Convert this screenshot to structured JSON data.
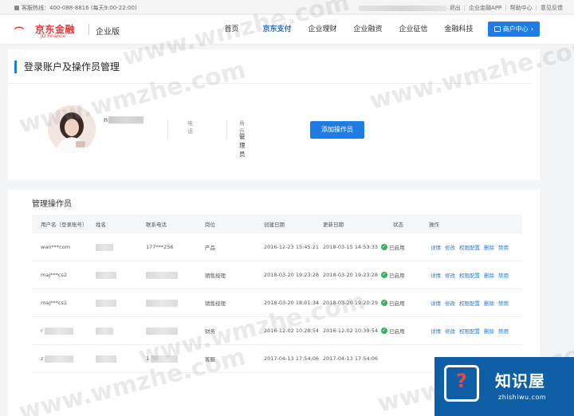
{
  "topbar": {
    "hotline": "客服热线：400-088-8816 (每天9:00-22:00)",
    "links": [
      "退出",
      "企业金融APP",
      "帮助中心",
      "意见反馈"
    ]
  },
  "header": {
    "logo_cn": "京东金融",
    "logo_en": "JD Finance",
    "edition": "企业版",
    "nav": [
      "首页",
      "京东支付",
      "企业理财",
      "企业融资",
      "企业征信",
      "金融科技"
    ],
    "active_nav": "京东支付",
    "merchant_button": "商户中心",
    "accent_color": "#1f7ce3",
    "brand_color": "#e4393c"
  },
  "page": {
    "title": "登录账户及操作员管理",
    "profile": {
      "username_visible": "n",
      "phone_label": "电话",
      "role_label": "角色",
      "role_value": "管理员",
      "add_button": "添加操作员"
    },
    "operators_title": "管理操作员",
    "table": {
      "columns": [
        "用户名（登录账号）",
        "姓名",
        "联系电话",
        "岗位",
        "创建日期",
        "更新日期",
        "状态",
        "操作"
      ],
      "rows": [
        {
          "username": "wan***com",
          "phone": "177***256",
          "position": "产品",
          "created": "2016-12-23 15:45:21",
          "updated": "2018-03-15 14:53:33",
          "status": "已启用"
        },
        {
          "username": "maj***cs2",
          "phone": "",
          "position": "销售经理",
          "created": "2018-03-20 19:23:28",
          "updated": "2018-03-20 19:23:28",
          "status": "已启用"
        },
        {
          "username": "maj***cs1",
          "phone": "",
          "position": "销售经理",
          "created": "2018-03-20 18:01:34",
          "updated": "2018-03-20 19:20:29",
          "status": "已启用"
        },
        {
          "username": "r",
          "phone": "",
          "position": "财务",
          "created": "2016-12-02 10:28:54",
          "updated": "2016-12-02 10:39:54",
          "status": "已启用"
        },
        {
          "username": "z",
          "phone": "1",
          "position": "客服",
          "created": "2017-04-13 17:54:06",
          "updated": "2017-04-13 17:54:06",
          "status": ""
        }
      ],
      "actions": [
        "详情",
        "修改",
        "权限配置",
        "删除",
        "禁用"
      ]
    }
  },
  "watermark": "www.wmzhe.com",
  "badge": {
    "name": "知识屋",
    "url": "zhishiwu.com"
  }
}
